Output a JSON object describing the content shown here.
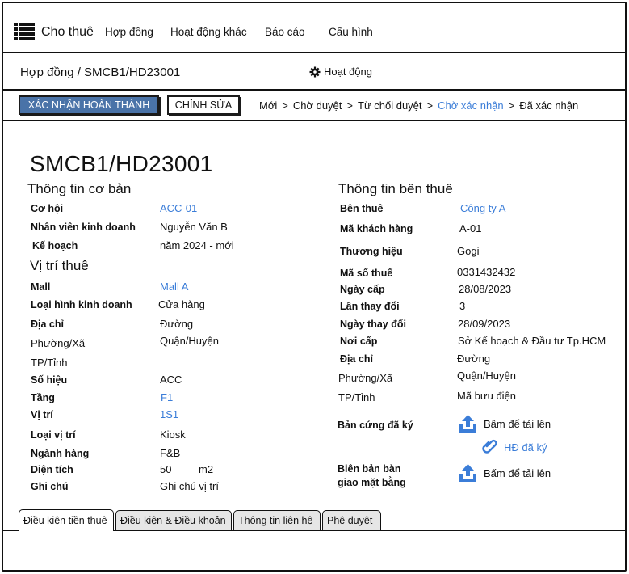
{
  "nav": {
    "app_title": "Cho thuê",
    "menu": [
      "Hợp đồng",
      "Hoạt động khác",
      "Báo cáo",
      "Cấu hình"
    ]
  },
  "subheader": {
    "breadcrumb": "Hợp đồng / SMCB1/HD23001",
    "activity_label": "Hoạt động"
  },
  "actions": {
    "confirm_label": "XÁC NHẬN HOÀN THÀNH",
    "edit_label": "CHỈNH SỬA"
  },
  "status_steps": [
    {
      "label": "Mới"
    },
    {
      "label": "Chờ duyệt"
    },
    {
      "label": "Từ chối duyệt"
    },
    {
      "label": "Chờ xác nhận",
      "active": true
    },
    {
      "label": "Đã xác nhận"
    }
  ],
  "contract": {
    "id": "SMCB1/HD23001"
  },
  "basic_info": {
    "heading": "Thông tin cơ bản",
    "opportunity_label": "Cơ hội",
    "opportunity_value": "ACC-01",
    "sales_label": "Nhân viên kinh doanh",
    "sales_value": "Nguyễn Văn B",
    "plan_label": "Kế hoạch",
    "plan_value": "năm 2024 - mới"
  },
  "location": {
    "heading": "Vị trí thuê",
    "mall_label": "Mall",
    "mall_value": "Mall A",
    "type_label": "Loại hình kinh doanh",
    "type_value": "Cửa hàng",
    "address_label": "Địa chỉ",
    "street": "Đường",
    "ward": "Phường/Xã",
    "district": "Quận/Huyện",
    "province": "TP/Tỉnh",
    "number_label": "Số hiệu",
    "number_value": "ACC",
    "floor_label": "Tầng",
    "floor_value": "F1",
    "position_label": "Vị trí",
    "position_value": "1S1",
    "position_type_label": "Loại vị trí",
    "position_type_value": "Kiosk",
    "category_label": "Ngành hàng",
    "category_value": "F&B",
    "area_label": "Diện tích",
    "area_value": "50",
    "area_unit": "m2",
    "note_label": "Ghi chú",
    "note_value": "Ghi chú vị trí"
  },
  "tenant": {
    "heading": "Thông tin bên thuê",
    "tenant_label": "Bên thuê",
    "tenant_value": "Công ty A",
    "customer_code_label": "Mã khách hàng",
    "customer_code_value": "A-01",
    "brand_label": "Thương hiệu",
    "brand_value": "Gogi",
    "tax_label": "Mã số thuế",
    "tax_value": "0331432432",
    "issue_date_label": "Ngày cấp",
    "issue_date_value": "28/08/2023",
    "change_count_label": "Lần thay đổi",
    "change_count_value": "3",
    "change_date_label": "Ngày thay đổi",
    "change_date_value": "28/09/2023",
    "issuer_label": "Nơi cấp",
    "issuer_value": "Sở Kế hoạch & Đầu tư Tp.HCM",
    "address_label": "Địa chỉ",
    "street": "Đường",
    "ward": "Phường/Xã",
    "district": "Quận/Huyện",
    "province": "TP/Tỉnh",
    "postal": "Mã bưu điện",
    "signed_copy_label": "Bản cứng đã ký",
    "upload_label": "Bấm để tải lên",
    "signed_file": "HĐ đã ký",
    "handover_label_1": "Biên bản bàn",
    "handover_label_2": "giao mặt bằng",
    "handover_upload_label": "Bấm để tải lên"
  },
  "tabs": [
    {
      "label": "Điều kiện tiền thuê",
      "active": true
    },
    {
      "label": "Điều kiện & Điều khoản"
    },
    {
      "label": "Thông tin liên hệ"
    },
    {
      "label": "Phê duyệt"
    }
  ]
}
